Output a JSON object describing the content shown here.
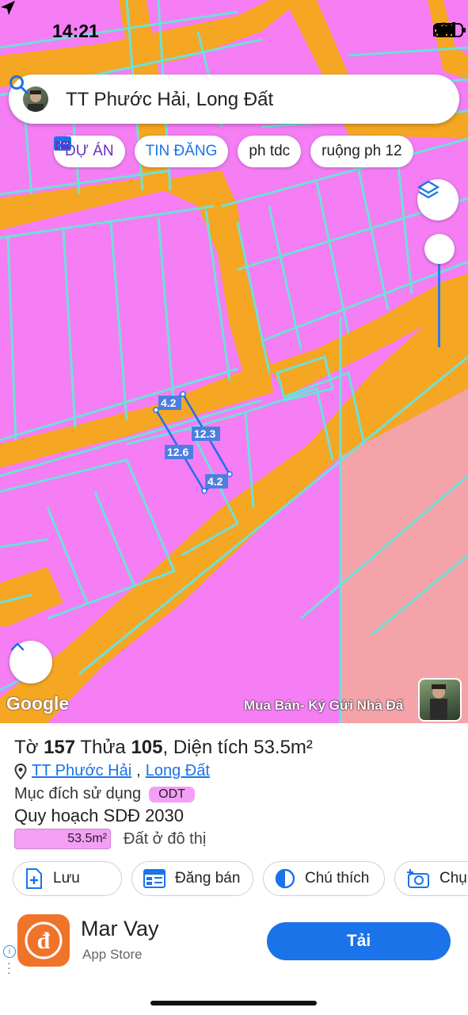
{
  "status_bar": {
    "time": "14:21"
  },
  "search": {
    "value": "TT Phước Hải, Long Đất"
  },
  "chips": [
    {
      "label": "DỰ ÁN",
      "icon": "building-icon"
    },
    {
      "label": "TIN ĐĂNG",
      "icon": "listing-icon"
    },
    {
      "label": "ph tdc"
    },
    {
      "label": "ruộng ph 12"
    }
  ],
  "map": {
    "dimensions": [
      "4.2",
      "12.3",
      "12.6",
      "4.2"
    ],
    "google_label": "Google",
    "attribution": "Mua Bán- Ký Gửi Nhà Đấ",
    "colors": {
      "residential": "#f57ef5",
      "road": "#f5a623",
      "parcel_line": "#6fe0d8",
      "commercial": "#f4a3a8",
      "selection": "#1e6ff0"
    }
  },
  "parcel": {
    "sheet_label": "Tờ",
    "sheet_no": "157",
    "lot_label": "Thửa",
    "lot_no": "105",
    "area_label": ", Diện tích",
    "area": "53.5m²",
    "ward": "TT Phước Hải",
    "district": "Long Đất",
    "purpose_label": "Mục đích sử dụng",
    "purpose_code": "ODT",
    "plan_label": "Quy hoạch SDĐ 2030",
    "plan_area": "53.5m²",
    "plan_type": "Đất ở đô thị"
  },
  "actions": [
    {
      "label": "Lưu",
      "icon": "add-doc-icon"
    },
    {
      "label": "Đăng bán",
      "icon": "table-icon"
    },
    {
      "label": "Chú thích",
      "icon": "contrast-icon"
    },
    {
      "label": "Chụp",
      "icon": "camera-add-icon"
    }
  ],
  "ad": {
    "app_name": "Mar Vay",
    "store": "App Store",
    "button": "Tải",
    "icon_glyph": "đ"
  }
}
